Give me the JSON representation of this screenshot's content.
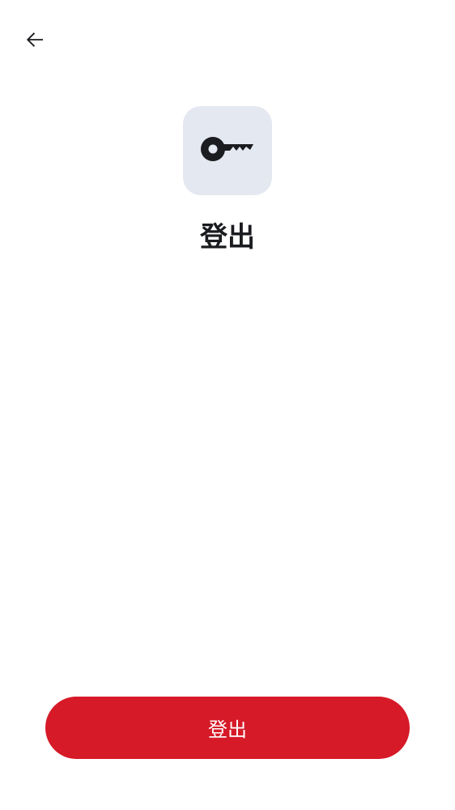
{
  "header": {
    "back_icon": "arrow-left-icon"
  },
  "hero": {
    "icon": "key-icon",
    "title": "登出"
  },
  "actions": {
    "logout_label": "登出"
  },
  "colors": {
    "tile_background": "#e4e8f0",
    "icon": "#1b1c20",
    "primary_button": "#d61a28",
    "button_text": "#ffffff"
  }
}
